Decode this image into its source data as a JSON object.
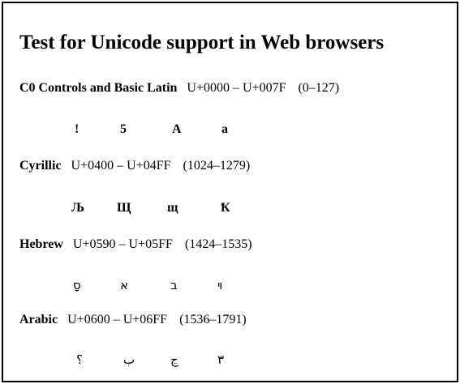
{
  "page": {
    "title": "Test for Unicode support in Web browsers"
  },
  "sections": [
    {
      "name": "C0 Controls and Basic Latin",
      "range": "U+0000 – U+007F",
      "decimal": "(0–127)",
      "samples": [
        "!",
        "5",
        "A",
        "a"
      ]
    },
    {
      "name": "Cyrillic",
      "range": "U+0400 – U+04FF",
      "decimal": "(1024–1279)",
      "samples": [
        "Љ",
        "Щ",
        "щ",
        "Ҟ"
      ]
    },
    {
      "name": "Hebrew",
      "range": "U+0590 – U+05FF",
      "decimal": "(1424–1535)",
      "samples": [
        "ָס",
        "א",
        "ב",
        "ױ"
      ]
    },
    {
      "name": "Arabic",
      "range": "U+0600 – U+06FF",
      "decimal": "(1536–1791)",
      "samples": [
        "؟",
        "ب",
        "ڃ",
        "٣"
      ]
    }
  ]
}
